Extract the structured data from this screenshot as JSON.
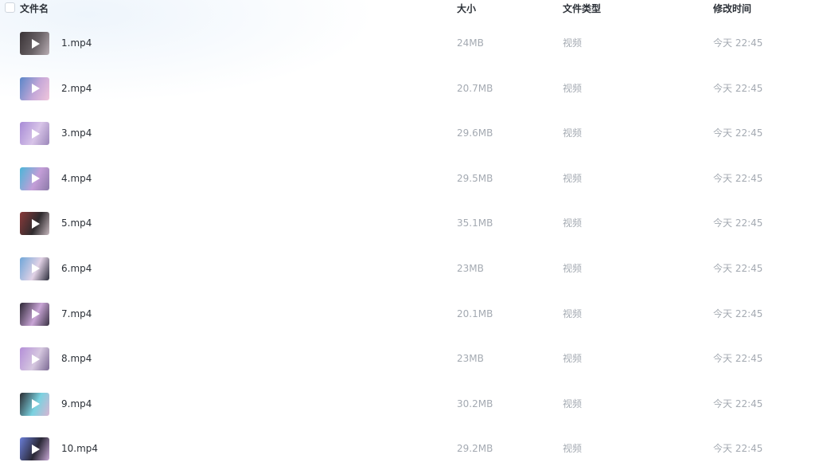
{
  "header": {
    "name": "文件名",
    "size": "大小",
    "type": "文件类型",
    "time": "修改时间"
  },
  "files": [
    {
      "name": "1.mp4",
      "size": "24MB",
      "type": "视频",
      "time": "今天 22:45",
      "thumb_colors": [
        "#3a3336",
        "#6a6367",
        "#b9aeb4"
      ]
    },
    {
      "name": "2.mp4",
      "size": "20.7MB",
      "type": "视频",
      "time": "今天 22:45",
      "thumb_colors": [
        "#5a86c8",
        "#c6a8d8",
        "#f0c6dc"
      ]
    },
    {
      "name": "3.mp4",
      "size": "29.6MB",
      "type": "视频",
      "time": "今天 22:45",
      "thumb_colors": [
        "#a78bd6",
        "#d8c4e8",
        "#9b87b9"
      ]
    },
    {
      "name": "4.mp4",
      "size": "29.5MB",
      "type": "视频",
      "time": "今天 22:45",
      "thumb_colors": [
        "#4bb6d8",
        "#c49ed8",
        "#8b7aa8"
      ]
    },
    {
      "name": "5.mp4",
      "size": "35.1MB",
      "type": "视频",
      "time": "今天 22:45",
      "thumb_colors": [
        "#8a3a3a",
        "#2f2b2e",
        "#c7b8be"
      ]
    },
    {
      "name": "6.mp4",
      "size": "23MB",
      "type": "视频",
      "time": "今天 22:45",
      "thumb_colors": [
        "#6fa6d8",
        "#e2d2e6",
        "#2a2c3a"
      ]
    },
    {
      "name": "7.mp4",
      "size": "20.1MB",
      "type": "视频",
      "time": "今天 22:45",
      "thumb_colors": [
        "#2c2634",
        "#c9a5d6",
        "#3a3344"
      ]
    },
    {
      "name": "8.mp4",
      "size": "23MB",
      "type": "视频",
      "time": "今天 22:45",
      "thumb_colors": [
        "#b48fd8",
        "#d6c8e0",
        "#7c6a94"
      ]
    },
    {
      "name": "9.mp4",
      "size": "30.2MB",
      "type": "视频",
      "time": "今天 22:45",
      "thumb_colors": [
        "#2a2a30",
        "#7ad2e0",
        "#d8b4d2"
      ]
    },
    {
      "name": "10.mp4",
      "size": "29.2MB",
      "type": "视频",
      "time": "今天 22:45",
      "thumb_colors": [
        "#6a7ed8",
        "#2a2836",
        "#c8a8d6"
      ]
    }
  ]
}
